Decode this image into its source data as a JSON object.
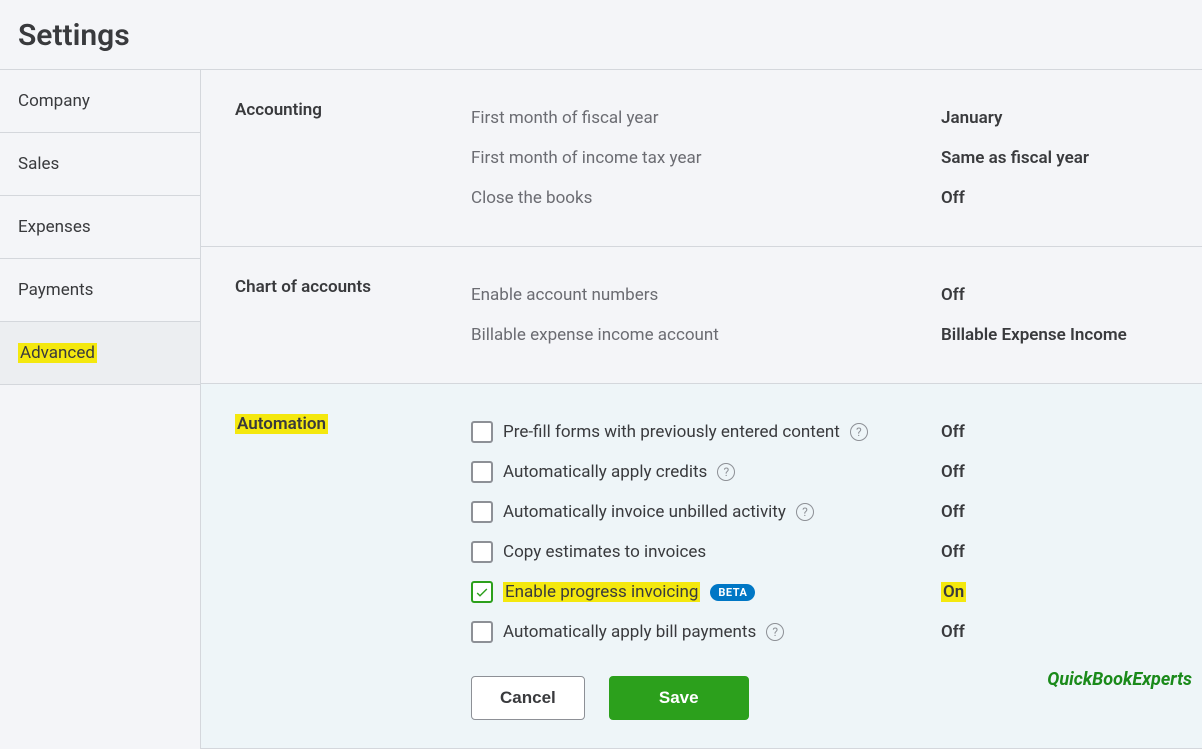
{
  "page_title": "Settings",
  "sidebar": {
    "items": [
      {
        "label": "Company",
        "active": false
      },
      {
        "label": "Sales",
        "active": false
      },
      {
        "label": "Expenses",
        "active": false
      },
      {
        "label": "Payments",
        "active": false
      },
      {
        "label": "Advanced",
        "active": true,
        "highlight": true
      }
    ]
  },
  "sections": {
    "accounting": {
      "title": "Accounting",
      "rows": [
        {
          "label": "First month of fiscal year",
          "value": "January"
        },
        {
          "label": "First month of income tax year",
          "value": "Same as fiscal year"
        },
        {
          "label": "Close the books",
          "value": "Off"
        }
      ]
    },
    "chart_of_accounts": {
      "title": "Chart of accounts",
      "rows": [
        {
          "label": "Enable account numbers",
          "value": "Off"
        },
        {
          "label": "Billable expense income account",
          "value": "Billable Expense Income"
        }
      ]
    },
    "automation": {
      "title": "Automation",
      "title_highlight": true,
      "options": [
        {
          "label": "Pre-fill forms with previously entered content",
          "checked": false,
          "help": true,
          "value": "Off"
        },
        {
          "label": "Automatically apply credits",
          "checked": false,
          "help": true,
          "value": "Off"
        },
        {
          "label": "Automatically invoice unbilled activity",
          "checked": false,
          "help": true,
          "value": "Off"
        },
        {
          "label": "Copy estimates to invoices",
          "checked": false,
          "help": false,
          "value": "Off"
        },
        {
          "label": "Enable progress invoicing",
          "checked": true,
          "help": false,
          "beta": "BETA",
          "value": "On",
          "highlight": true,
          "value_highlight": true
        },
        {
          "label": "Automatically apply bill payments",
          "checked": false,
          "help": true,
          "value": "Off"
        }
      ],
      "buttons": {
        "cancel": "Cancel",
        "save": "Save"
      }
    }
  },
  "watermark": "QuickBookExperts"
}
